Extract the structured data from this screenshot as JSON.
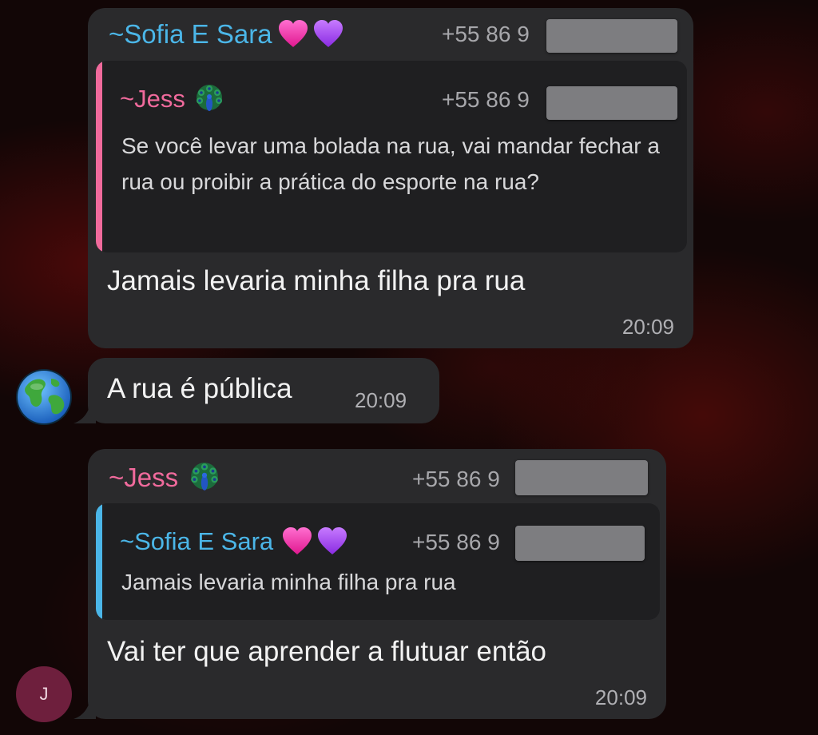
{
  "messages": [
    {
      "sender": "~Sofia E Sara",
      "sender_color": "#4bb6e8",
      "sender_emoji": [
        "pink-heart-icon",
        "purple-heart-icon"
      ],
      "phone": "+55 86 9",
      "reply": {
        "sender": "~Jess",
        "sender_color": "#f06a9c",
        "sender_emoji": "peacock-icon",
        "phone": "+55 86 9",
        "text": "Se você levar uma bolada na rua, vai mandar fechar a rua ou proibir a prática do esporte na rua?"
      },
      "text": "Jamais levaria minha filha pra rua",
      "time": "20:09"
    },
    {
      "avatar_icon": "globe-icon",
      "text": "A rua é pública",
      "time": "20:09"
    },
    {
      "sender": "~Jess",
      "sender_color": "#f06a9c",
      "sender_emoji": "peacock-icon",
      "phone": "+55 86 9",
      "reply": {
        "sender": "~Sofia E Sara",
        "sender_color": "#4bb6e8",
        "sender_emoji": [
          "pink-heart-icon",
          "purple-heart-icon"
        ],
        "phone": "+55 86 9",
        "text": "Jamais levaria minha filha pra rua"
      },
      "text": "Vai ter que aprender a flutuar então",
      "time": "20:09",
      "avatar_initial": "J",
      "avatar_color": "#6e1f3d"
    }
  ]
}
